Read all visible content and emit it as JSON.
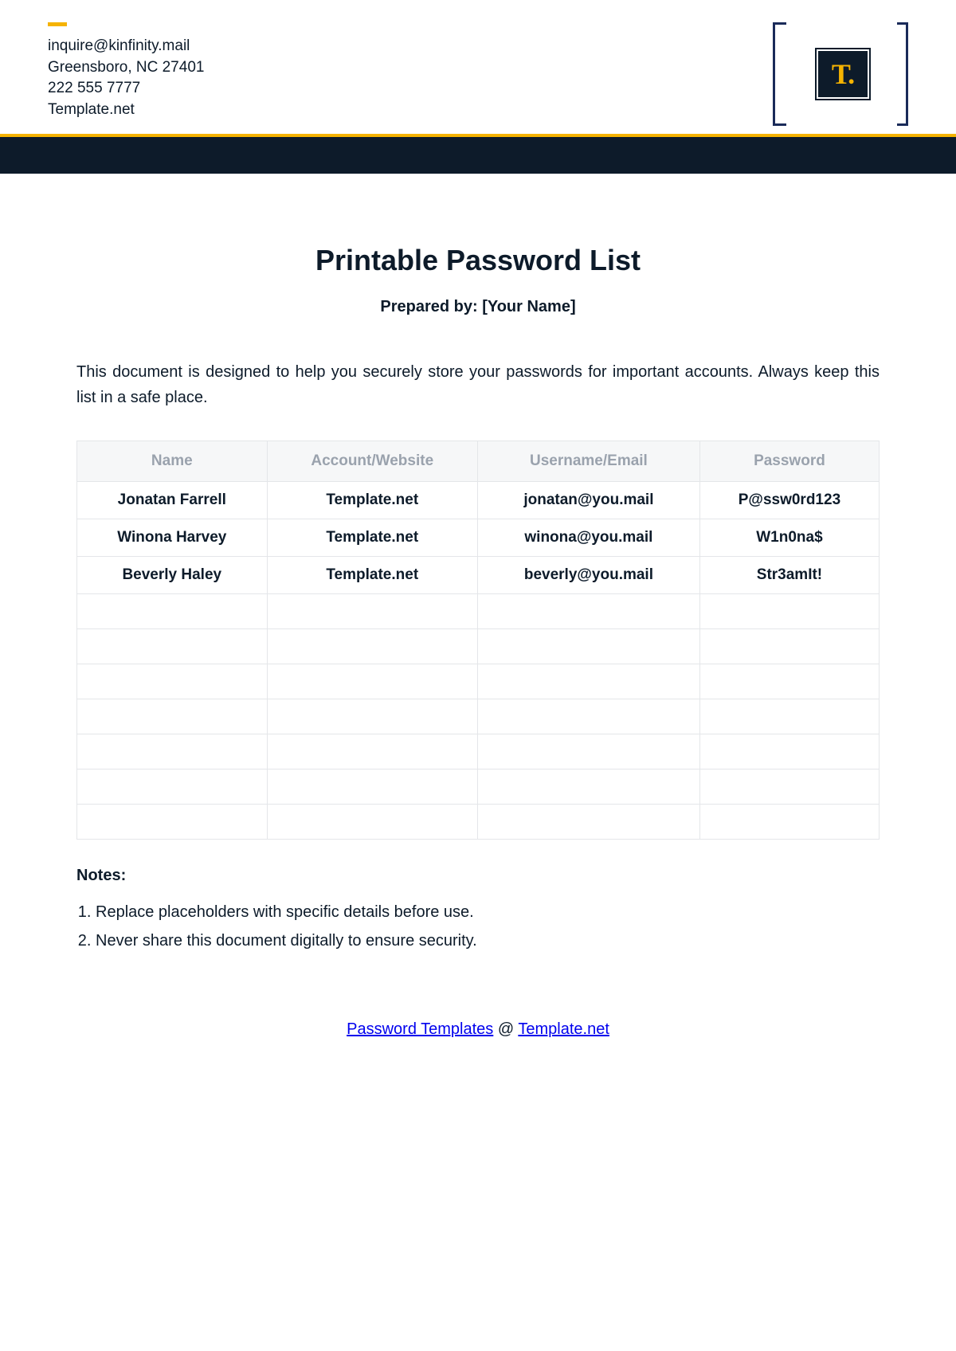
{
  "header": {
    "contact": {
      "email": "inquire@kinfinity.mail",
      "address": "Greensboro, NC 27401",
      "phone": "222 555 7777",
      "site": "Template.net"
    },
    "logo_text": "T."
  },
  "main": {
    "title": "Printable Password List",
    "subtitle": "Prepared by: [Your Name]",
    "description": "This document is designed to help you securely store your passwords for important accounts. Always keep this list in a safe place.",
    "table": {
      "headers": [
        "Name",
        "Account/Website",
        "Username/Email",
        "Password"
      ],
      "rows": [
        [
          "Jonatan Farrell",
          "Template.net",
          "jonatan@you.mail",
          "P@ssw0rd123"
        ],
        [
          "Winona Harvey",
          "Template.net",
          "winona@you.mail",
          "W1n0na$"
        ],
        [
          "Beverly Haley",
          "Template.net",
          "beverly@you.mail",
          "Str3amIt!"
        ],
        [
          "",
          "",
          "",
          ""
        ],
        [
          "",
          "",
          "",
          ""
        ],
        [
          "",
          "",
          "",
          ""
        ],
        [
          "",
          "",
          "",
          ""
        ],
        [
          "",
          "",
          "",
          ""
        ],
        [
          "",
          "",
          "",
          ""
        ],
        [
          "",
          "",
          "",
          ""
        ]
      ]
    },
    "notes_heading": "Notes:",
    "notes": [
      "Replace placeholders with specific details before use.",
      "Never share this document digitally to ensure security."
    ]
  },
  "footer": {
    "link1_text": "Password Templates",
    "separator": " @ ",
    "link2_text": "Template.net"
  }
}
